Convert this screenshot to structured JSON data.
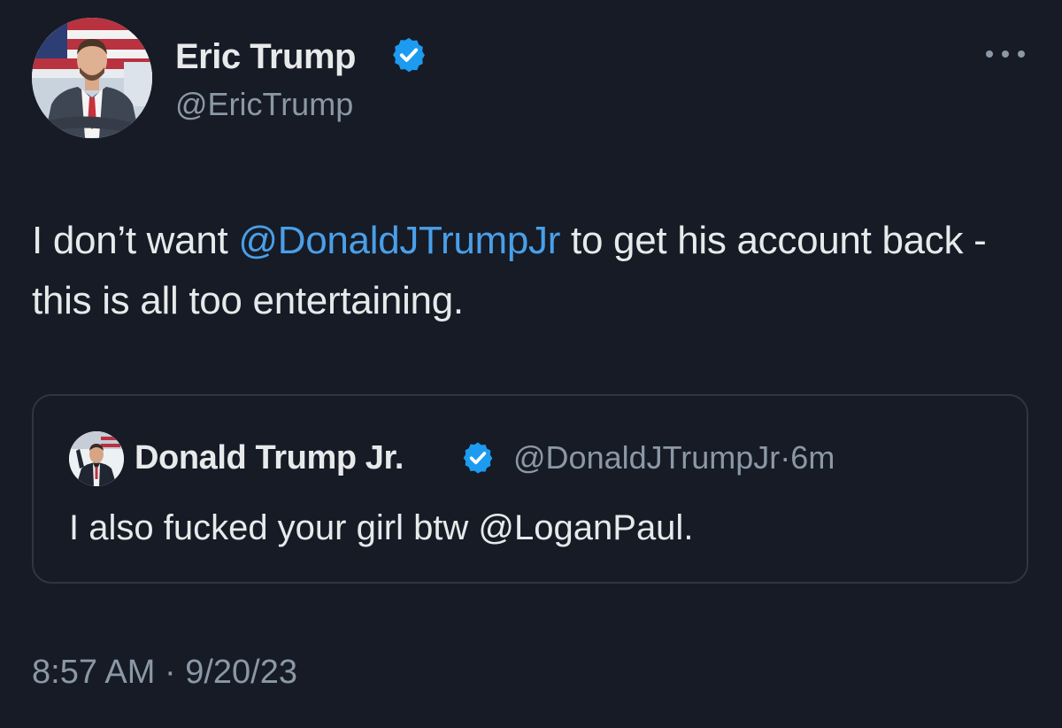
{
  "author": {
    "display_name": "Eric Trump",
    "handle": "@EricTrump",
    "verified": true
  },
  "tweet": {
    "text_before": "I don’t want ",
    "mention": "@DonaldJTrumpJr",
    "text_after": " to get his account back - this is all too entertaining."
  },
  "quote": {
    "display_name": "Donald Trump Jr.",
    "verified": true,
    "handle": "@DonaldJTrumpJr",
    "separator": "·",
    "age": "6m",
    "text": "I also fucked your girl btw @LoganPaul."
  },
  "timestamp": {
    "time": "8:57 AM",
    "separator": "·",
    "date": "9/20/23"
  },
  "icons": {
    "verified": "verified-badge-icon",
    "more": "more-options-icon"
  },
  "colors": {
    "background": "#161b26",
    "text": "#e7e9ea",
    "secondary_text": "#8b98a5",
    "link": "#4a9fe8",
    "verified_badge": "#1d9bf0",
    "card_border": "#2f3640"
  }
}
